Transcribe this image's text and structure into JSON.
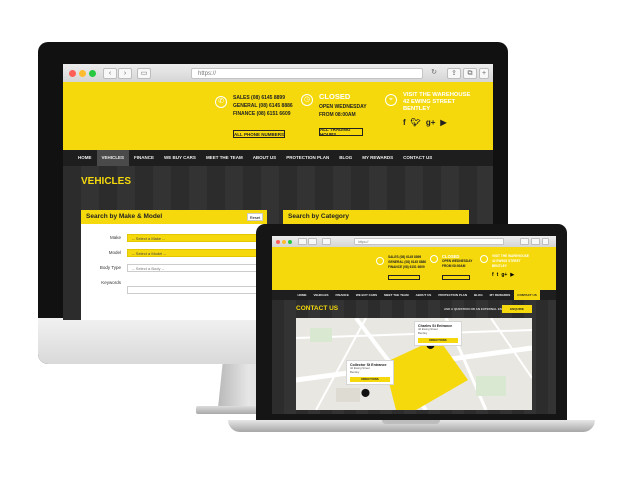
{
  "desktop": {
    "url": "https://",
    "header": {
      "phones": [
        "SALES (08) 6145 8899",
        "GENERAL (08) 6145 8886",
        "FINANCE (08) 6151 6609"
      ],
      "phones_button": "ALL PHONE NUMBERS",
      "status_title": "CLOSED",
      "status_lines": [
        "OPEN WEDNESDAY",
        "FROM 08:00AM"
      ],
      "hours_button": "ALL TRADING HOURS",
      "visit_lines": [
        "VISIT THE WAREHOUSE",
        "42 EWING STREET",
        "BENTLEY"
      ],
      "social": [
        "f",
        "t",
        "g+",
        "yt"
      ]
    },
    "nav": [
      "HOME",
      "VEHICLES",
      "FINANCE",
      "WE BUY CARS",
      "MEET THE TEAM",
      "ABOUT US",
      "PROTECTION PLAN",
      "BLOG",
      "MY REWARDS",
      "CONTACT US"
    ],
    "page_title": "VEHICLES",
    "search_panel": {
      "title": "Search by Make & Model",
      "reset": "Reset",
      "fields": [
        {
          "label": "Make",
          "value": "-- Select a Make --",
          "highlight": true
        },
        {
          "label": "Model",
          "value": "-- Select a Model --",
          "highlight": true
        },
        {
          "label": "Body Type",
          "value": "-- Select a Body --",
          "highlight": false
        },
        {
          "label": "Keywords",
          "value": "",
          "highlight": false
        }
      ]
    },
    "category_panel": {
      "title": "Search by Category"
    }
  },
  "laptop": {
    "url": "https://",
    "header": {
      "phones": [
        "SALES (08) 6145 8899",
        "GENERAL (08) 6145 8886",
        "FINANCE (08) 6151 6609"
      ],
      "status_lines": [
        "CLOSED",
        "OPEN WEDNESDAY",
        "FROM 08:00AM"
      ],
      "visit_lines": [
        "VISIT THE WAREHOUSE",
        "42 EWING STREET",
        "BENTLEY"
      ]
    },
    "nav": [
      "HOME",
      "VEHICLES",
      "FINANCE",
      "WE BUY CARS",
      "MEET THE TEAM",
      "ABOUT US",
      "PROTECTION PLAN",
      "BLOG",
      "MY REWARDS",
      "CONTACT US"
    ],
    "page_title": "CONTACT US",
    "ask_text": "ASK A QUESTION OR AN EXTERNAL ENQUIRY",
    "enquire_button": "ENQUIRE",
    "map": {
      "box1": {
        "title": "Charles St Entrance",
        "lines": [
          "42 Ewing Street",
          "Bentley"
        ],
        "button": "DIRECTIONS"
      },
      "box2": {
        "title": "Collector St Entrance",
        "lines": [
          "42 Ewing Street",
          "Bentley"
        ],
        "button": "DIRECTIONS"
      }
    }
  },
  "colors": {
    "accent": "#f5d90c",
    "nav": "#1e1e1e"
  }
}
